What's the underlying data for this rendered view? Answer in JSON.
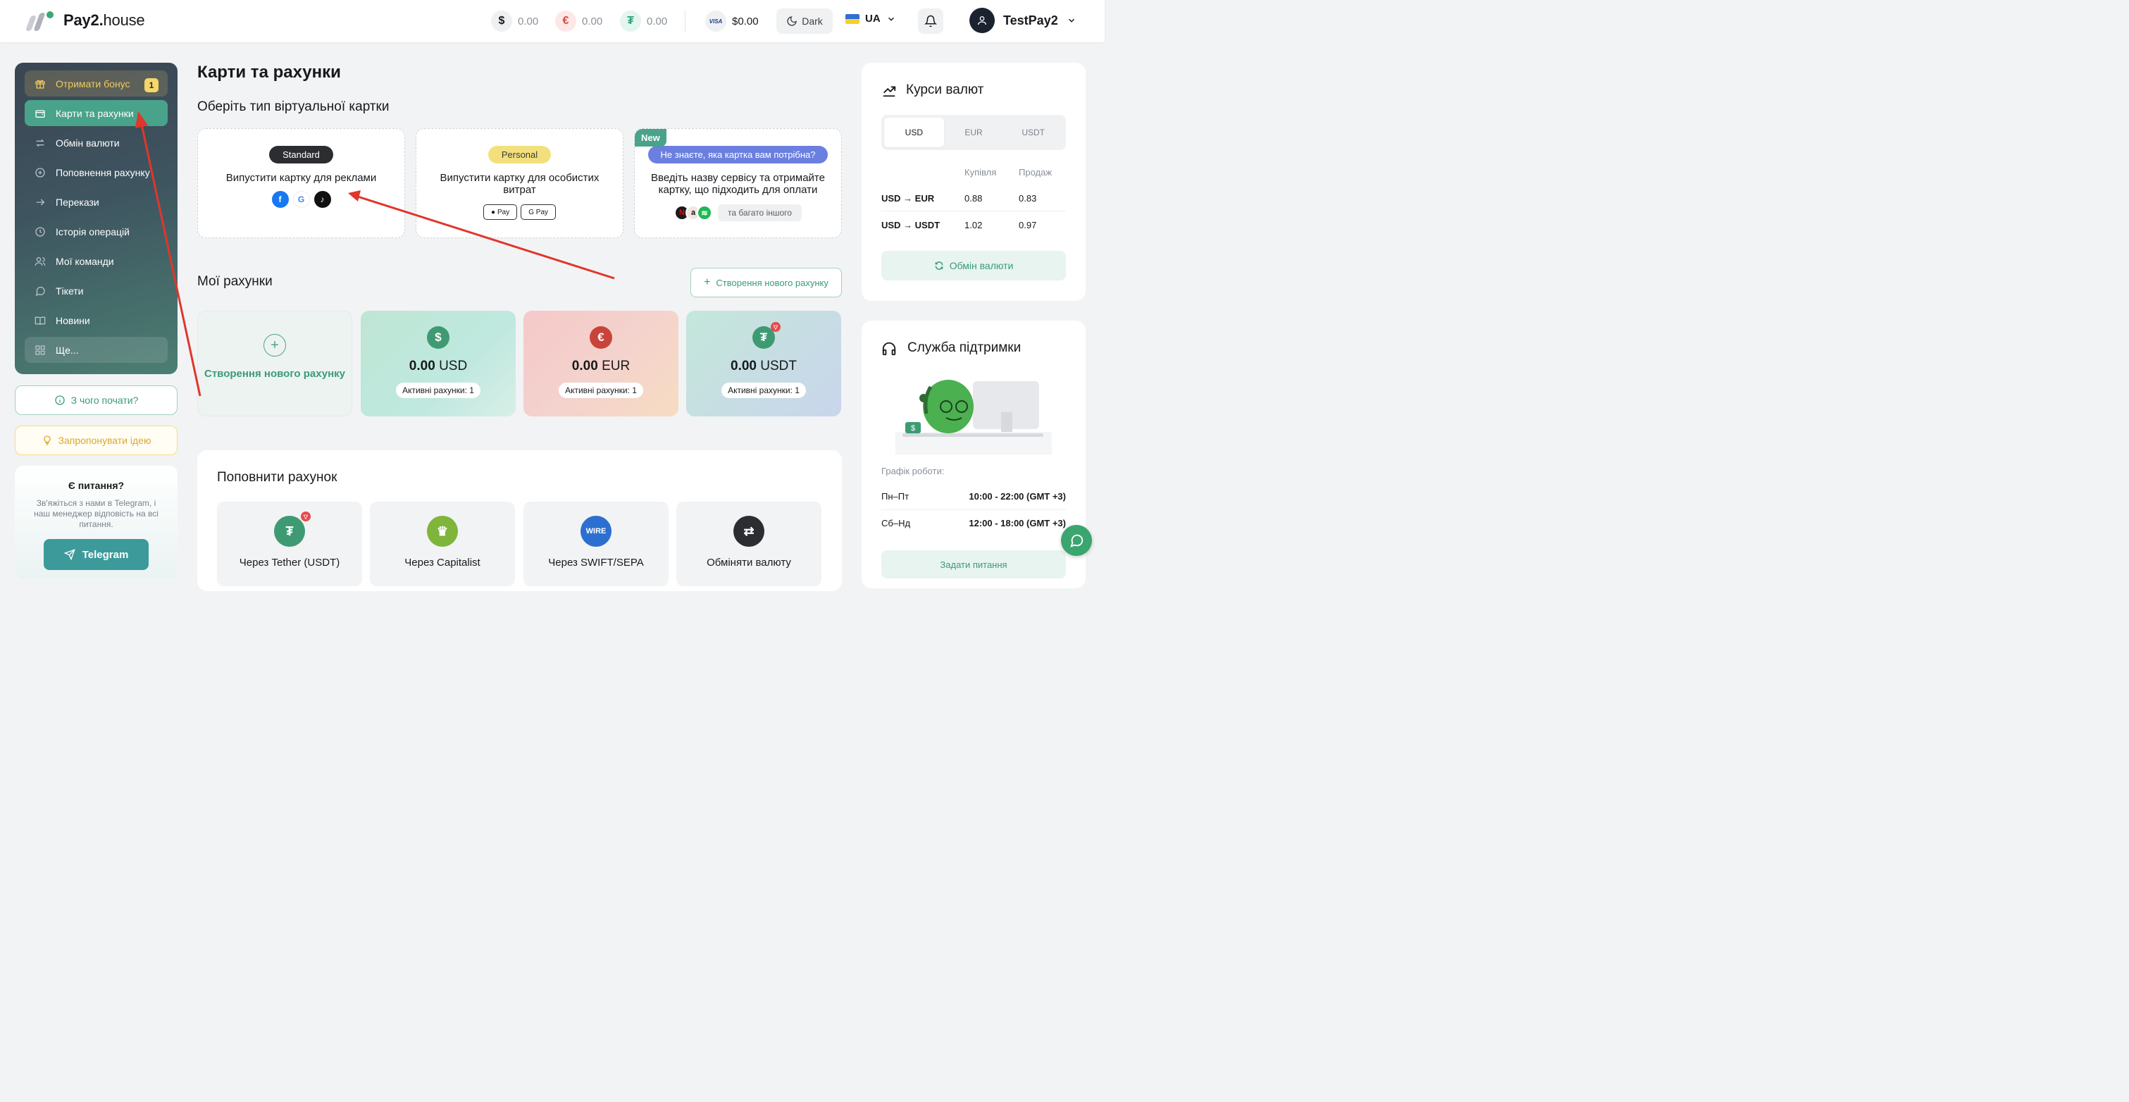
{
  "header": {
    "logo_text_main": "Pay2.",
    "logo_text_light": "house",
    "balances": [
      {
        "icon": "dollar-icon",
        "symbol": "$",
        "value": "0.00"
      },
      {
        "icon": "euro-icon",
        "symbol": "€",
        "value": "0.00"
      },
      {
        "icon": "tether-icon",
        "symbol": "₮",
        "value": "0.00"
      }
    ],
    "card_balance": {
      "icon": "visa-icon",
      "symbol": "VISA",
      "value": "$0.00"
    },
    "theme_label": "Dark",
    "language": "UA",
    "username": "TestPay2"
  },
  "sidebar": {
    "items": [
      {
        "label": "Отримати бонус",
        "icon": "gift-icon",
        "badge": "1"
      },
      {
        "label": "Карти та рахунки",
        "icon": "wallet-icon"
      },
      {
        "label": "Обмін валюти",
        "icon": "exchange-icon"
      },
      {
        "label": "Поповнення рахунку",
        "icon": "plus-circle-icon"
      },
      {
        "label": "Перекази",
        "icon": "arrow-right-icon"
      },
      {
        "label": "Історія операцій",
        "icon": "history-icon"
      },
      {
        "label": "Мої команди",
        "icon": "users-icon"
      },
      {
        "label": "Тікети",
        "icon": "chat-icon"
      },
      {
        "label": "Новини",
        "icon": "book-icon"
      },
      {
        "label": "Ще...",
        "icon": "grid-icon"
      }
    ],
    "start_label": "З чого почати?",
    "idea_label": "Запропонувати ідею",
    "question": {
      "title": "Є питання?",
      "text": "Зв'яжіться з нами в Telegram, і наш менеджер відповість на всі питання.",
      "button": "Telegram"
    }
  },
  "main": {
    "title": "Карти та рахунки",
    "card_type_heading": "Оберіть тип віртуальної картки",
    "card_types": [
      {
        "tag": "Standard",
        "desc": "Випустити картку для реклами"
      },
      {
        "tag": "Personal",
        "desc": "Випустити картку для особистих витрат",
        "pay": [
          "Pay",
          "G Pay"
        ]
      },
      {
        "new": "New",
        "tag": "Не знаєте, яка картка вам потрібна?",
        "desc": "Введіть назву сервісу та отримайте картку, що підходить для оплати",
        "more": "та багато іншого"
      }
    ],
    "accounts_heading": "Мої рахунки",
    "new_account_btn": "Створення нового рахунку",
    "create_card_label": "Створення нового рахунку",
    "accounts": [
      {
        "amount": "0.00",
        "currency": "USD",
        "symbol": "$",
        "active": "Активні рахунки: 1"
      },
      {
        "amount": "0.00",
        "currency": "EUR",
        "symbol": "€",
        "active": "Активні рахунки: 1"
      },
      {
        "amount": "0.00",
        "currency": "USDT",
        "symbol": "₮",
        "active": "Активні рахунки: 1"
      }
    ],
    "topup_heading": "Поповнити рахунок",
    "topup_methods": [
      {
        "label": "Через Tether (USDT)",
        "icon": "tether-icon"
      },
      {
        "label": "Через Capitalist",
        "icon": "capitalist-icon"
      },
      {
        "label": "Через SWIFT/SEPA",
        "icon": "wire-icon"
      },
      {
        "label": "Обміняти валюту",
        "icon": "swap-icon"
      }
    ]
  },
  "rates": {
    "title": "Курси валют",
    "tabs": [
      "USD",
      "EUR",
      "USDT"
    ],
    "col_buy": "Купівля",
    "col_sell": "Продаж",
    "rows": [
      {
        "pair": "USD → EUR",
        "buy": "0.88",
        "sell": "0.83"
      },
      {
        "pair": "USD → USDT",
        "buy": "1.02",
        "sell": "0.97"
      }
    ],
    "exchange_btn": "Обмін валюти"
  },
  "support": {
    "title": "Служба підтримки",
    "schedule_label": "Графік роботи:",
    "rows": [
      {
        "days": "Пн–Пт",
        "hours": "10:00 - 22:00 (GMT +3)"
      },
      {
        "days": "Сб–Нд",
        "hours": "12:00 - 18:00 (GMT +3)"
      }
    ],
    "ask_btn": "Задати питання"
  },
  "colors": {
    "accent": "#48a38a",
    "annotation": "#e0362c",
    "bonus": "#f4c95d"
  }
}
